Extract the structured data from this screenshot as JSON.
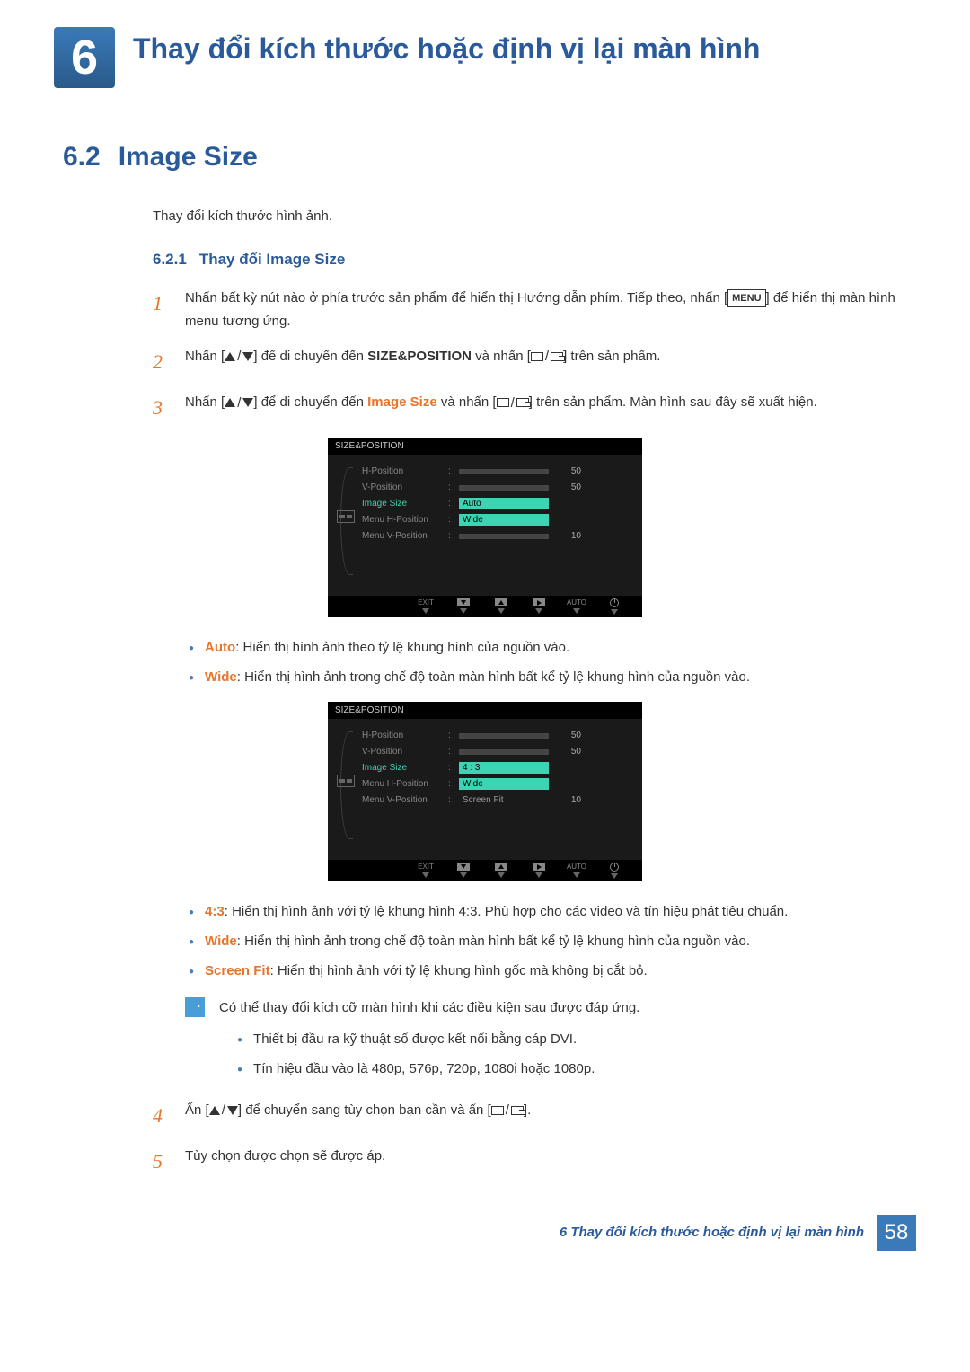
{
  "chapter": {
    "number": "6",
    "title": "Thay đổi kích thước hoặc định vị lại màn hình"
  },
  "section": {
    "number": "6.2",
    "title": "Image Size"
  },
  "intro": "Thay đổi kích thước hình ảnh.",
  "subsection": {
    "number": "6.2.1",
    "title": "Thay đổi Image Size"
  },
  "steps": {
    "s1": {
      "num": "1",
      "t1": "Nhấn bất kỳ nút nào ở phía trước sản phẩm để hiển thị Hướng dẫn phím. Tiếp theo, nhấn [",
      "menu": "MENU",
      "t2": "] để hiển thị màn hình menu tương ứng."
    },
    "s2": {
      "num": "2",
      "t1": "Nhấn [",
      "t2": "] để di chuyển đến ",
      "target": "SIZE&POSITION",
      "t3": " và nhấn [",
      "t4": "] trên sản phẩm."
    },
    "s3": {
      "num": "3",
      "t1": "Nhấn [",
      "t2": "] để di chuyển đến ",
      "target": "Image Size",
      "t3": " và nhấn [",
      "t4": "] trên sản phẩm. Màn hình sau đây sẽ xuất hiện."
    },
    "s4": {
      "num": "4",
      "t1": "Ấn [",
      "t2": "] để chuyển sang tùy chọn bạn cần và ấn [",
      "t3": "]."
    },
    "s5": {
      "num": "5",
      "text": "Tùy chọn được chọn sẽ được áp."
    }
  },
  "osd1": {
    "title": "SIZE&POSITION",
    "rows": {
      "r1": {
        "label": "H-Position",
        "val": "50"
      },
      "r2": {
        "label": "V-Position",
        "val": "50"
      },
      "r3": {
        "label": "Image Size",
        "sel": "Auto",
        "opt": "Wide"
      },
      "r4": {
        "label": "Menu H-Position"
      },
      "r5": {
        "label": "Menu V-Position",
        "val": "10"
      }
    },
    "btns": {
      "exit": "EXIT",
      "auto": "AUTO"
    }
  },
  "osd2": {
    "title": "SIZE&POSITION",
    "rows": {
      "r1": {
        "label": "H-Position",
        "val": "50"
      },
      "r2": {
        "label": "V-Position",
        "val": "50"
      },
      "r3": {
        "label": "Image Size",
        "sel": "4 : 3",
        "opt1": "Wide",
        "opt2": "Screen Fit"
      },
      "r4": {
        "label": "Menu H-Position"
      },
      "r5": {
        "label": "Menu V-Position",
        "val": "10"
      }
    },
    "btns": {
      "exit": "EXIT",
      "auto": "AUTO"
    }
  },
  "bullets1": {
    "b1": {
      "term": "Auto",
      "desc": ": Hiển thị hình ảnh theo tỷ lệ khung hình của nguồn vào."
    },
    "b2": {
      "term": "Wide",
      "desc": ": Hiển thị hình ảnh trong chế độ toàn màn hình bất kể tỷ lệ khung hình của nguồn vào."
    }
  },
  "bullets2": {
    "b1": {
      "term": "4:3",
      "desc": ": Hiển thị hình ảnh với tỷ lệ khung hình 4:3. Phù hợp cho các video và tín hiệu phát tiêu chuẩn."
    },
    "b2": {
      "term": "Wide",
      "desc": ": Hiển thị hình ảnh trong chế độ toàn màn hình bất kể tỷ lệ khung hình của nguồn vào."
    },
    "b3": {
      "term": "Screen Fit",
      "desc": ": Hiển thị hình ảnh với tỷ lệ khung hình gốc mà không bị cắt bỏ."
    }
  },
  "note": {
    "intro": "Có thể thay đổi kích cỡ màn hình khi các điều kiện sau được đáp ứng.",
    "i1": "Thiết bị đầu ra kỹ thuật số được kết nối bằng cáp DVI.",
    "i2": "Tín hiệu đầu vào là 480p, 576p, 720p, 1080i hoặc 1080p."
  },
  "footer": {
    "text": "6 Thay đổi kích thước hoặc định vị lại màn hình",
    "page": "58"
  }
}
